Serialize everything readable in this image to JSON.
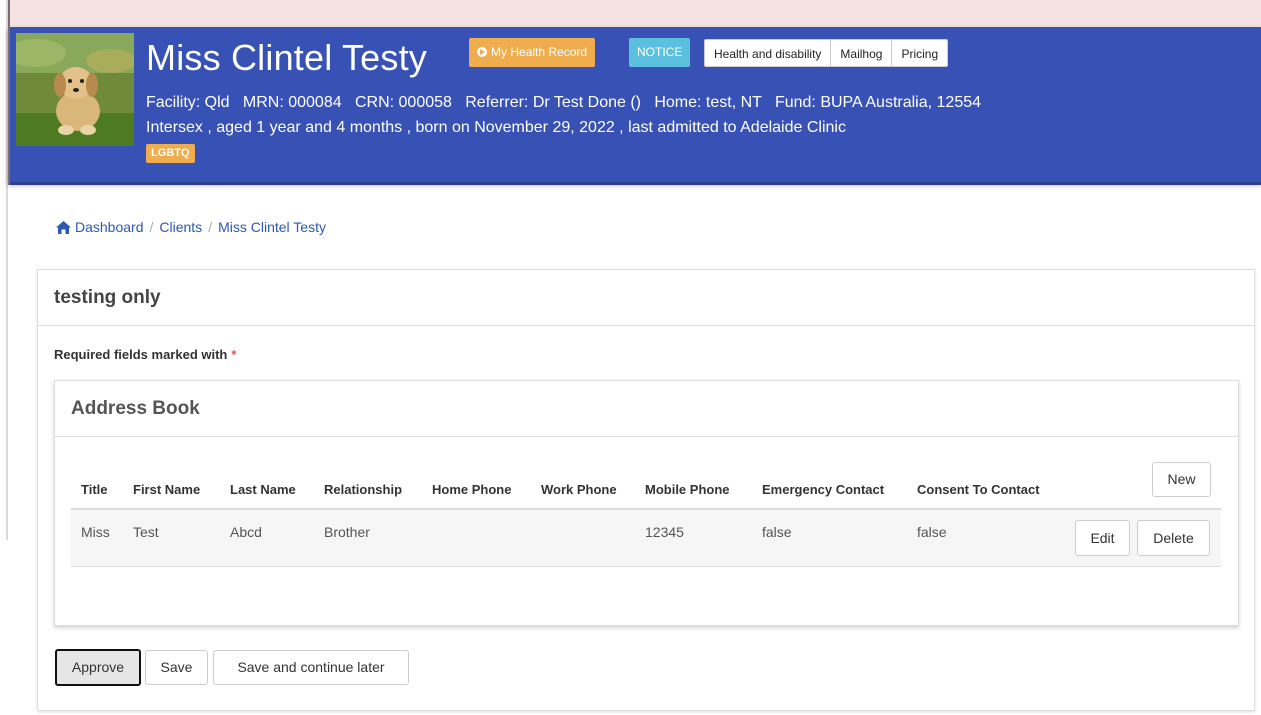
{
  "header": {
    "client_name": "Miss Clintel Testy",
    "my_health_record": "My Health Record",
    "notice": "NOTICE",
    "buttons": [
      "Health and disability",
      "Mailhog",
      "Pricing"
    ],
    "info_line": "Facility: Qld   MRN: 000084   CRN: 000058   Referrer: Dr Test Done ()   Home: test, NT   Fund: BUPA Australia, 12554",
    "demographics_line": "Intersex , aged 1 year and 4 months , born on November 29, 2022 , last admitted to Adelaide Clinic",
    "tag": "LGBTQ",
    "accent_color": "#3851b5"
  },
  "breadcrumb": {
    "icon": "home-icon",
    "items": [
      "Dashboard",
      "Clients",
      "Miss Clintel Testy"
    ]
  },
  "form": {
    "title": "testing only",
    "required_note": "Required fields marked with",
    "required_marker": "*"
  },
  "address_book": {
    "title": "Address Book",
    "columns": [
      "Title",
      "First Name",
      "Last Name",
      "Relationship",
      "Home Phone",
      "Work Phone",
      "Mobile Phone",
      "Emergency Contact",
      "Consent To Contact"
    ],
    "rows": [
      {
        "title": "Miss",
        "first_name": "Test",
        "last_name": "Abcd",
        "relationship": "Brother",
        "home_phone": "",
        "work_phone": "",
        "mobile_phone": "12345",
        "emergency_contact": "false",
        "consent_to_contact": "false"
      }
    ],
    "new_label": "New",
    "edit_label": "Edit",
    "delete_label": "Delete"
  },
  "actions": {
    "approve": "Approve",
    "save": "Save",
    "save_later": "Save and continue later"
  }
}
